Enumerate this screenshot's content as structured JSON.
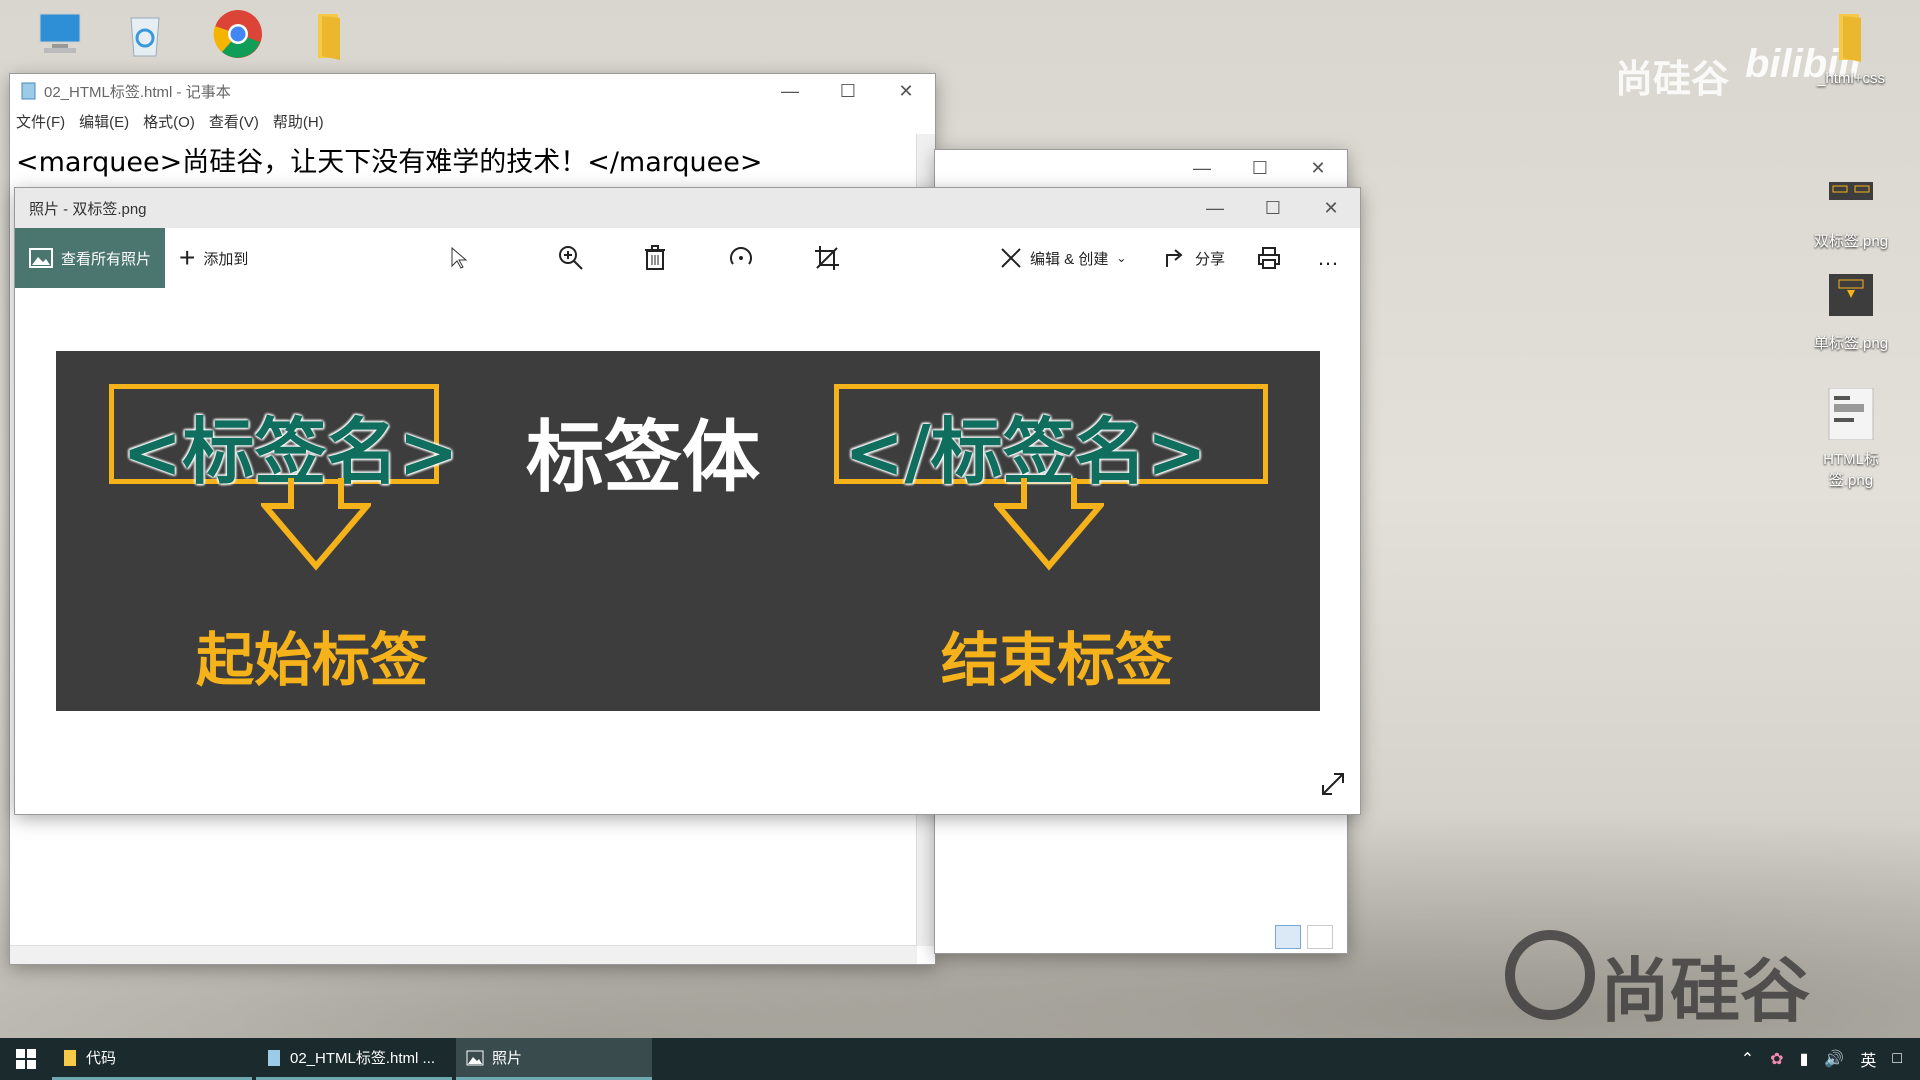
{
  "desktop": {
    "right_icons": [
      {
        "label": "_html+css"
      },
      {
        "label": "双标签.png"
      },
      {
        "label": "单标签.png"
      },
      {
        "label": "HTML标签.png"
      }
    ],
    "watermark_top": "尚硅谷",
    "watermark_brand": "bilibili",
    "watermark_bottom": "尚硅谷"
  },
  "notepad": {
    "title": "02_HTML标签.html - 记事本",
    "menu": [
      "文件(F)",
      "编辑(E)",
      "格式(O)",
      "查看(V)",
      "帮助(H)"
    ],
    "content": "<marquee>尚硅谷，让天下没有难学的技术！</marquee>"
  },
  "photos": {
    "title": "照片 - 双标签.png",
    "view_all": "查看所有照片",
    "add_to": "添加到",
    "edit_create": "编辑 & 创建",
    "share": "分享",
    "image": {
      "open_tag": "<标签名>",
      "body": "标签体",
      "close_tag": "</标签名>",
      "start_label": "起始标签",
      "end_label": "结束标签"
    }
  },
  "taskbar": {
    "items": [
      {
        "label": "代码"
      },
      {
        "label": "02_HTML标签.html ..."
      },
      {
        "label": "照片"
      }
    ],
    "ime": "英"
  },
  "colors": {
    "accent": "#4b7670",
    "tag_yellow": "#f5b21a",
    "tag_green": "#0f6e5e",
    "stage_bg": "#3d3d3d"
  }
}
